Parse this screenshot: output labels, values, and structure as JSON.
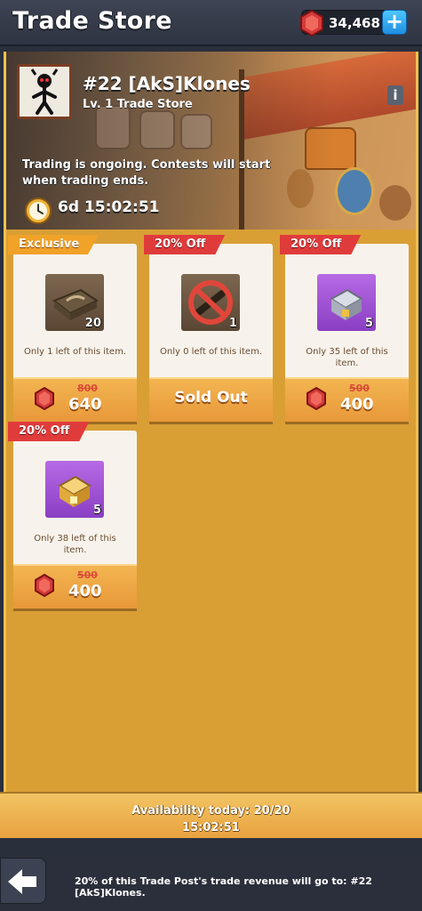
{
  "header": {
    "title": "Trade Store",
    "gem_balance": "34,468",
    "add_button_label": "+"
  },
  "store": {
    "name": "#22 [AkS]Klones",
    "level_label": "Lv. 1 Trade Store",
    "info_label": "i",
    "message": "Trading is ongoing. Contests will start when trading ends.",
    "timer": "6d 15:02:51"
  },
  "items": [
    {
      "tag": "Exclusive",
      "tag_color": "#f0a229",
      "icon": "wrapped-package-icon",
      "count": "20",
      "stock_text": "Only 1 left of this item.",
      "old_price": "800",
      "price": "640",
      "sold_out_label": ""
    },
    {
      "tag": "20% Off",
      "tag_color": "#e03b3b",
      "icon": "prohibited-item-icon",
      "count": "1",
      "stock_text": "Only 0 left of this item.",
      "old_price": "",
      "price": "",
      "sold_out_label": "Sold Out"
    },
    {
      "tag": "20% Off",
      "tag_color": "#e03b3b",
      "icon": "silver-treasure-icon",
      "count": "5",
      "stock_text": "Only 35 left of this item.",
      "old_price": "500",
      "price": "400",
      "sold_out_label": ""
    },
    {
      "tag": "20% Off",
      "tag_color": "#e03b3b",
      "icon": "gold-treasure-icon",
      "count": "5",
      "stock_text": "Only 38 left of this item.",
      "old_price": "500",
      "price": "400",
      "sold_out_label": ""
    }
  ],
  "footer": {
    "availability": "Availability today: 20/20",
    "reset_timer": "15:02:51"
  },
  "bottom_bar": {
    "note": "20% of this Trade Post's trade revenue will go to: #22 [AkS]Klones."
  },
  "colors": {
    "accent_orange": "#e9a23f",
    "discount_red": "#e03b3b",
    "gem_red": "#d63a3a",
    "panel_bg": "#d99f35"
  }
}
